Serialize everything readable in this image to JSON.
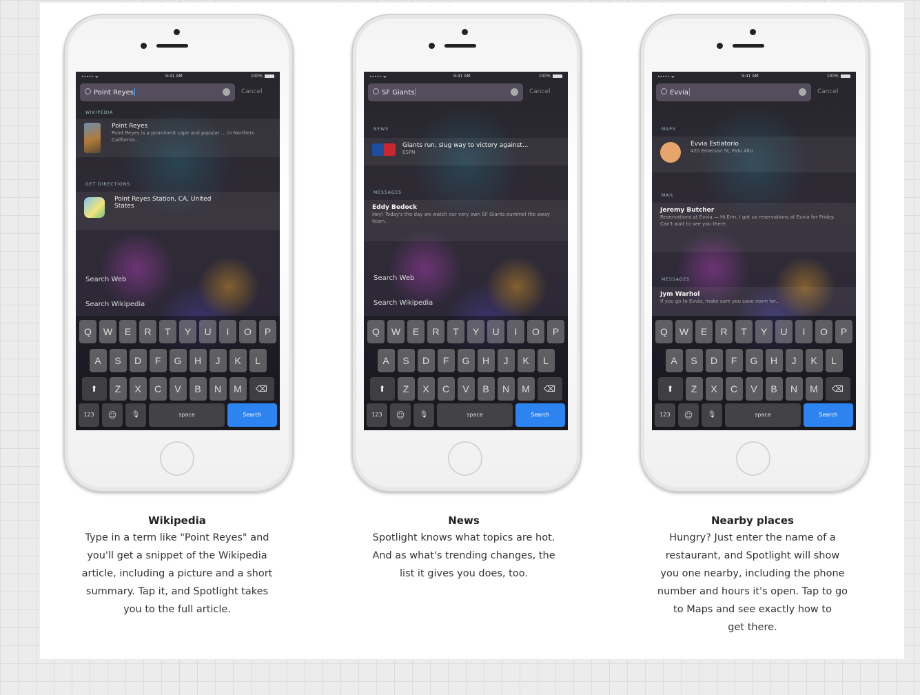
{
  "phones": [
    {
      "status": {
        "carrier": "••••• ᯤ",
        "time": "9:41 AM",
        "battery": "100%"
      },
      "search": {
        "query": "Point Reyes",
        "cancel": "Cancel"
      },
      "sections": [
        {
          "label": "WIKIPEDIA",
          "title": "Point Reyes",
          "sub": "Point Reyes is a prominent cape and popular ... in Northern California..."
        },
        {
          "label": "GET DIRECTIONS",
          "title": "Point Reyes Station, CA, United States",
          "sub": ""
        }
      ],
      "links": [
        "Search Web",
        "Search Wikipedia"
      ],
      "caption": {
        "title": "Wikipedia",
        "lines": [
          "Type in a term like \"Point Reyes\" and",
          "you'll get a snippet of the Wikipedia",
          "article, including a picture and a short",
          "summary. Tap it, and Spotlight takes",
          "you to the full article."
        ]
      }
    },
    {
      "status": {
        "carrier": "••••• ᯤ",
        "time": "9:41 AM",
        "battery": "100%"
      },
      "search": {
        "query": "SF Giants",
        "cancel": "Cancel"
      },
      "sections": [
        {
          "label": "NEWS",
          "title": "Giants run, slug way to victory against...",
          "sub": "ESPN"
        },
        {
          "label": "MESSAGES",
          "title": "Eddy Bedock",
          "sub": "Hey! Today's the day we watch our very own SF Giants pummel the away team."
        }
      ],
      "links": [
        "Search Web",
        "Search Wikipedia"
      ],
      "caption": {
        "title": "News",
        "lines": [
          "Spotlight knows what topics are hot.",
          "And as what's trending changes, the",
          "list it gives you does, too."
        ]
      }
    },
    {
      "status": {
        "carrier": "••••• ᯤ",
        "time": "9:41 AM",
        "battery": "100%"
      },
      "search": {
        "query": "Evvia",
        "cancel": "Cancel"
      },
      "sections": [
        {
          "label": "MAPS",
          "title": "Evvia Estiatorio",
          "sub": "420 Emerson St, Palo Alto"
        },
        {
          "label": "MAIL",
          "title": "Jeremy Butcher",
          "sub": "Reservations at Evvia — Hi Erin, I got us reservations at Evvia for Friday. Can't wait to see you there."
        },
        {
          "label": "MESSAGES",
          "title": "Jym Warhol",
          "sub": "If you go to Evvia, make sure you save room for..."
        }
      ],
      "links": [],
      "caption": {
        "title": "Nearby places",
        "lines": [
          "Hungry? Just enter the name of a",
          "restaurant, and Spotlight will show",
          "you one nearby, including the phone",
          "number and hours it's open. Tap to go",
          "to Maps and see exactly how to",
          "get there."
        ]
      }
    }
  ],
  "keyboard": {
    "row1": [
      "Q",
      "W",
      "E",
      "R",
      "T",
      "Y",
      "U",
      "I",
      "O",
      "P"
    ],
    "row2": [
      "A",
      "S",
      "D",
      "F",
      "G",
      "H",
      "J",
      "K",
      "L"
    ],
    "row3": [
      "Z",
      "X",
      "C",
      "V",
      "B",
      "N",
      "M"
    ],
    "shift": "⬆",
    "delete": "⌫",
    "numbers": "123",
    "emoji": "☺",
    "mic": "🎙",
    "space": "space",
    "search": "Search"
  }
}
